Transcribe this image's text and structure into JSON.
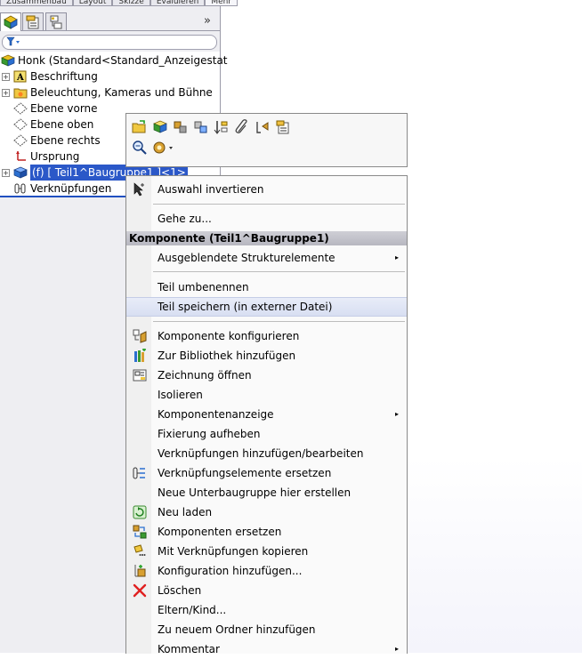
{
  "top_tabs": [
    "Zusammenbau",
    "Layout",
    "Skizze",
    "Evaluieren",
    "Mehr"
  ],
  "panel_tabs": [
    "feature-manager-tab",
    "property-manager-tab",
    "configuration-manager-tab"
  ],
  "panel_more": "»",
  "tree": {
    "root": "Honk  (Standard<Standard_Anzeigestat",
    "items": [
      {
        "label": "Beschriftung",
        "expander": "+"
      },
      {
        "label": "Beleuchtung, Kameras und Bühne",
        "expander": "+"
      },
      {
        "label": "Ebene vorne",
        "expander": ""
      },
      {
        "label": "Ebene oben",
        "expander": ""
      },
      {
        "label": "Ebene rechts",
        "expander": ""
      },
      {
        "label": "Ursprung",
        "expander": ""
      },
      {
        "label": "(f) [ Teil1^Baugruppe1 ]<1>",
        "expander": "+"
      },
      {
        "label": "Verknüpfungen",
        "expander": ""
      }
    ]
  },
  "menu": {
    "invert": "Auswahl invertieren",
    "goto": "Gehe zu...",
    "header": "Komponente (Teil1^Baugruppe1)",
    "hidden_features": "Ausgeblendete Strukturelemente",
    "rename": "Teil umbenennen",
    "save_external": "Teil speichern (in externer Datei)",
    "items": [
      {
        "label": "Komponente konfigurieren",
        "icon": "configure-component-icon"
      },
      {
        "label": "Zur Bibliothek hinzufügen",
        "icon": "add-to-library-icon"
      },
      {
        "label": "Zeichnung öffnen",
        "icon": "open-drawing-icon"
      },
      {
        "label": "Isolieren",
        "icon": ""
      },
      {
        "label": "Komponentenanzeige",
        "icon": "",
        "submenu": true
      },
      {
        "label": "Fixierung aufheben",
        "icon": ""
      },
      {
        "label": "Verknüpfungen hinzufügen/bearbeiten",
        "icon": ""
      },
      {
        "label": "Verknüpfungselemente ersetzen",
        "icon": "replace-mate-entities-icon"
      },
      {
        "label": "Neue Unterbaugruppe hier erstellen",
        "icon": ""
      },
      {
        "label": "Neu laden",
        "icon": "reload-icon"
      },
      {
        "label": "Komponenten ersetzen",
        "icon": "replace-components-icon"
      },
      {
        "label": "Mit Verknüpfungen kopieren",
        "icon": "copy-with-mates-icon"
      },
      {
        "label": "Konfiguration hinzufügen...",
        "icon": "add-configuration-icon"
      },
      {
        "label": "Löschen",
        "icon": "delete-icon"
      },
      {
        "label": "Eltern/Kind...",
        "icon": ""
      },
      {
        "label": "Zu neuem Ordner hinzufügen",
        "icon": ""
      },
      {
        "label": "Kommentar",
        "icon": "",
        "submenu": true
      }
    ]
  },
  "colors": {
    "selection": "#2b58c8",
    "menu_header": "#c3c3cb",
    "delete_red": "#e02020"
  }
}
